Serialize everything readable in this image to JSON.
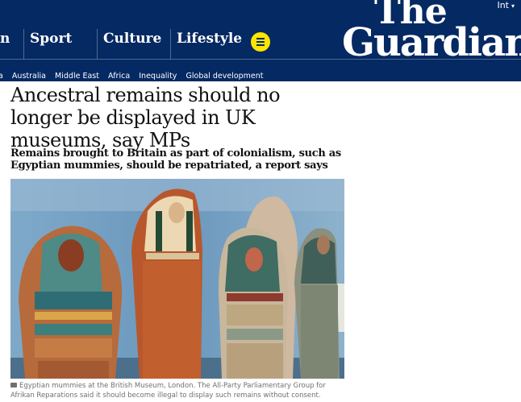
{
  "masthead": {
    "edition": "Int",
    "logo_line1": "The",
    "logo_line2": "Guardian",
    "pillars": [
      "n",
      "Sport",
      "Culture",
      "Lifestyle"
    ]
  },
  "subnav": {
    "items": [
      "a",
      "Australia",
      "Middle East",
      "Africa",
      "Inequality",
      "Global development"
    ]
  },
  "article": {
    "headline": "Ancestral remains should no longer be displayed in UK museums, say MPs",
    "standfirst": "Remains brought to Britain as part of colonialism, such as Egyptian mummies, should be repatriated, a report says",
    "caption": "Egyptian mummies at the British Museum, London. The All-Party Parliamentary Group for Afrikan Reparations said it should become illegal to display such remains without consent."
  },
  "colors": {
    "brand_navy": "#052962",
    "menu_yellow": "#ffe500",
    "text": "#121212",
    "caption": "#707070"
  },
  "icons": [
    "menu-icon",
    "chevron-down-icon",
    "camera-icon"
  ]
}
